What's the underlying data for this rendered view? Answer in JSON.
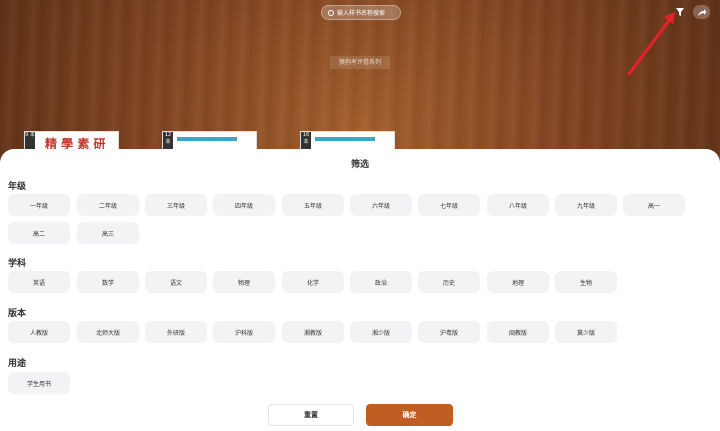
{
  "search": {
    "placeholder": "输入样书名称搜索",
    "icon": "search-icon"
  },
  "shelf": {
    "title": "猿狗考评卷系列"
  },
  "books": [
    {
      "badge": "9\n本",
      "cover": "精 學 素 研"
    },
    {
      "badge": "12\n本",
      "cover": ""
    },
    {
      "badge": "16\n本",
      "cover": ""
    }
  ],
  "filter_sheet": {
    "title": "筛选",
    "sections": [
      {
        "label": "年级",
        "options": [
          "一年级",
          "二年级",
          "三年级",
          "四年级",
          "五年级",
          "六年级",
          "七年级",
          "八年级",
          "九年级",
          "高一",
          "高二",
          "高三"
        ]
      },
      {
        "label": "学科",
        "options": [
          "英语",
          "数学",
          "语文",
          "物理",
          "化学",
          "政治",
          "历史",
          "地理",
          "生物"
        ]
      },
      {
        "label": "版本",
        "options": [
          "人教版",
          "北师大版",
          "外研版",
          "沪科版",
          "湘教版",
          "湘少版",
          "沪粤版",
          "闽教版",
          "冀少版"
        ]
      },
      {
        "label": "用途",
        "options": [
          "学生用书"
        ]
      }
    ],
    "reset_label": "重置",
    "confirm_label": "确定"
  },
  "colors": {
    "accent": "#c05d22",
    "chip_bg": "#f3f3f5",
    "annotation_arrow": "#e8202a"
  }
}
